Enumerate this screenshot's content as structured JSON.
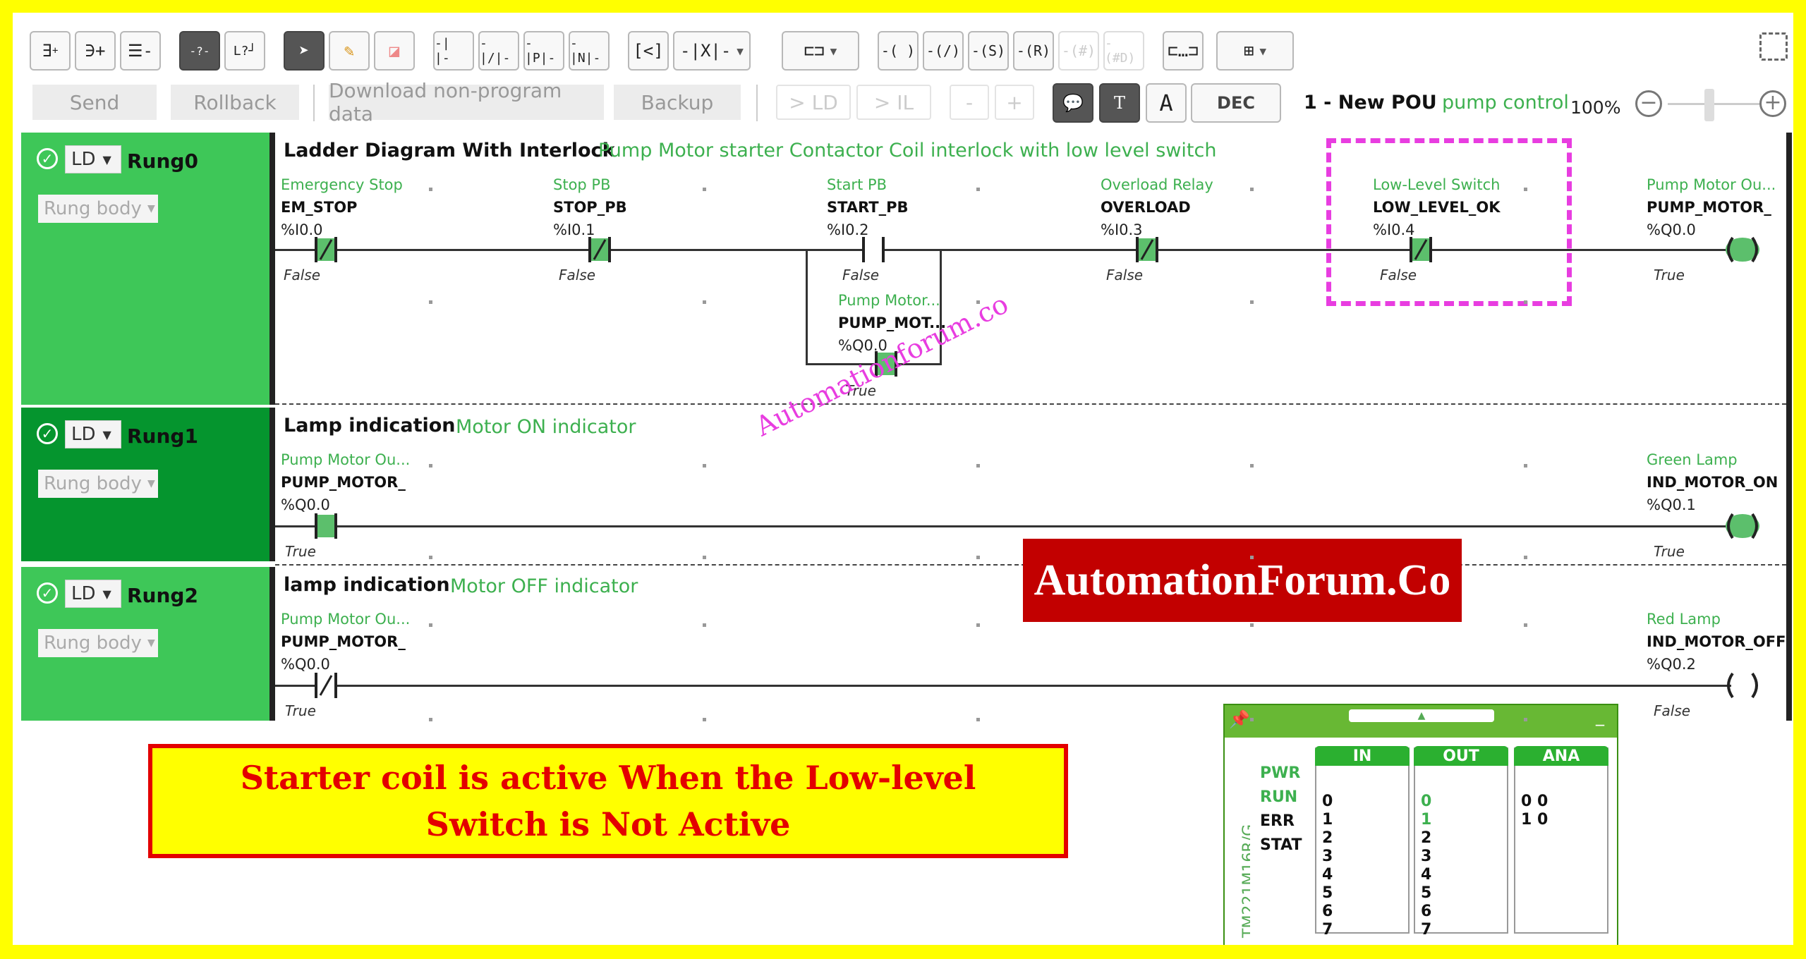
{
  "toolbar": {
    "icons": [
      "insert-rung-icon",
      "insert-branch-icon",
      "delete-rung-icon",
      "contact-unknown-icon",
      "coil-unknown-icon",
      "pointer-icon",
      "pencil-icon",
      "eraser-icon",
      "contact-no-icon",
      "contact-nc-icon",
      "contact-p-icon",
      "contact-n-icon",
      "compare-block-icon",
      "operation-block-icon",
      "function-block-icon",
      "coil-icon",
      "coil-negated-icon",
      "coil-set-icon",
      "coil-reset-icon",
      "coil-hash-icon",
      "coil-hashd-icon",
      "box-icon",
      "add-box-icon"
    ],
    "send": "Send",
    "rollback": "Rollback",
    "download": "Download non-program data",
    "backup": "Backup",
    "to_ld": "> LD",
    "to_il": "> IL",
    "minus": "-",
    "plus": "+",
    "dec": "DEC",
    "pou_name": "1 - New POU",
    "pou_comment": "pump control",
    "zoom": "100%"
  },
  "rungs": [
    {
      "lang": "LD",
      "name": "Rung0",
      "body": "Rung body",
      "title": "Ladder Diagram With Interlock",
      "comment": "Pump Motor starter Contactor Coil interlock with low level switch",
      "contacts": [
        {
          "label": "Emergency Stop",
          "var": "EM_STOP",
          "addr": "%I0.0",
          "state": "False"
        },
        {
          "label": "Stop PB",
          "var": "STOP_PB",
          "addr": "%I0.1",
          "state": "False"
        },
        {
          "label": "Start PB",
          "var": "START_PB",
          "addr": "%I0.2",
          "state": "False"
        },
        {
          "label": "Overload Relay",
          "var": "OVERLOAD",
          "addr": "%I0.3",
          "state": "False"
        },
        {
          "label": "Low-Level Switch",
          "var": "LOW_LEVEL_OK",
          "addr": "%I0.4",
          "state": "False"
        }
      ],
      "branch": {
        "label": "Pump Motor...",
        "var": "PUMP_MOT...",
        "addr": "%Q0.0",
        "state": "True"
      },
      "coil": {
        "label": "Pump Motor Ou...",
        "var": "PUMP_MOTOR_",
        "addr": "%Q0.0",
        "state": "True"
      }
    },
    {
      "lang": "LD",
      "name": "Rung1",
      "body": "Rung body",
      "title": "Lamp indication",
      "comment": "Motor ON indicator",
      "contact": {
        "label": "Pump Motor Ou...",
        "var": "PUMP_MOTOR_",
        "addr": "%Q0.0",
        "state": "True"
      },
      "coil": {
        "label": "Green Lamp",
        "var": "IND_MOTOR_ON",
        "addr": "%Q0.1",
        "state": "True"
      }
    },
    {
      "lang": "LD",
      "name": "Rung2",
      "body": "Rung body",
      "title": "lamp indication",
      "comment": "Motor OFF indicator",
      "contact": {
        "label": "Pump Motor Ou...",
        "var": "PUMP_MOTOR_",
        "addr": "%Q0.0",
        "state": "True"
      },
      "coil": {
        "label": "Red Lamp",
        "var": "IND_MOTOR_OFF",
        "addr": "%Q0.2",
        "state": "False"
      }
    }
  ],
  "plc": {
    "model": "TM221M16R/G",
    "status": [
      "PWR",
      "RUN",
      "ERR",
      "STAT"
    ],
    "in_header": "IN",
    "out_header": "OUT",
    "ana_header": "ANA",
    "in": [
      "0",
      "1",
      "2",
      "3",
      "4",
      "5",
      "6",
      "7"
    ],
    "out": [
      "0",
      "1",
      "2",
      "3",
      "4",
      "5",
      "6",
      "7"
    ],
    "ana": [
      "0 0",
      "1 0"
    ]
  },
  "banner": {
    "line1": "Starter coil is active When the Low-level",
    "line2": "Switch is Not Active"
  },
  "logo": "AutomationForum.Co",
  "watermark": "Automationforum.co",
  "colors": {
    "rung_green": "#3ec758",
    "rung_selected": "#05952e",
    "label_green": "#3db04f",
    "highlight": "#e83de0",
    "banner_red": "#e30000",
    "frame_yellow": "#ffff00"
  }
}
